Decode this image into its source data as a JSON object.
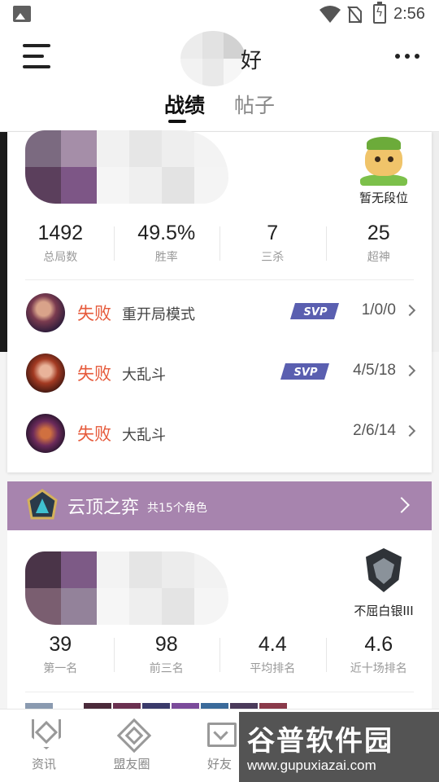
{
  "status_bar": {
    "time": "2:56",
    "icons": [
      "gallery-icon",
      "wifi-icon",
      "no-sim-icon",
      "battery-charging-icon"
    ]
  },
  "header": {
    "name_visible_suffix": "好",
    "tabs": [
      {
        "label": "战绩",
        "active": true
      },
      {
        "label": "帖子",
        "active": false
      }
    ],
    "menu_icon": "menu-icon",
    "more_icon": "more-icon"
  },
  "lol_card": {
    "rank_label": "暂无段位",
    "stats": [
      {
        "value": "1492",
        "label": "总局数"
      },
      {
        "value": "49.5%",
        "label": "胜率"
      },
      {
        "value": "7",
        "label": "三杀"
      },
      {
        "value": "25",
        "label": "超神"
      }
    ],
    "matches": [
      {
        "result": "失败",
        "mode": "重开局模式",
        "svp": true,
        "kda": "1/0/0"
      },
      {
        "result": "失败",
        "mode": "大乱斗",
        "svp": true,
        "kda": "4/5/18"
      },
      {
        "result": "失败",
        "mode": "大乱斗",
        "svp": false,
        "kda": "2/6/14"
      }
    ],
    "svp_label": "SVP"
  },
  "tft": {
    "title": "云顶之弈",
    "subtitle": "共15个角色",
    "rank_label": "不屈白银III",
    "stats": [
      {
        "value": "39",
        "label": "第一名"
      },
      {
        "value": "98",
        "label": "前三名"
      },
      {
        "value": "4.4",
        "label": "平均排名"
      },
      {
        "value": "4.6",
        "label": "近十场排名"
      }
    ]
  },
  "bottom_nav": [
    {
      "label": "资讯",
      "icon": "news-icon"
    },
    {
      "label": "盟友圈",
      "icon": "ally-circle-icon"
    },
    {
      "label": "好友",
      "icon": "friends-icon"
    }
  ],
  "watermark": {
    "title": "谷普软件园",
    "url": "www.gupuxiazai.com"
  },
  "colors": {
    "defeat": "#e65a3b",
    "tft_bar": "#a784ae",
    "svp": "#5a5fb0"
  }
}
